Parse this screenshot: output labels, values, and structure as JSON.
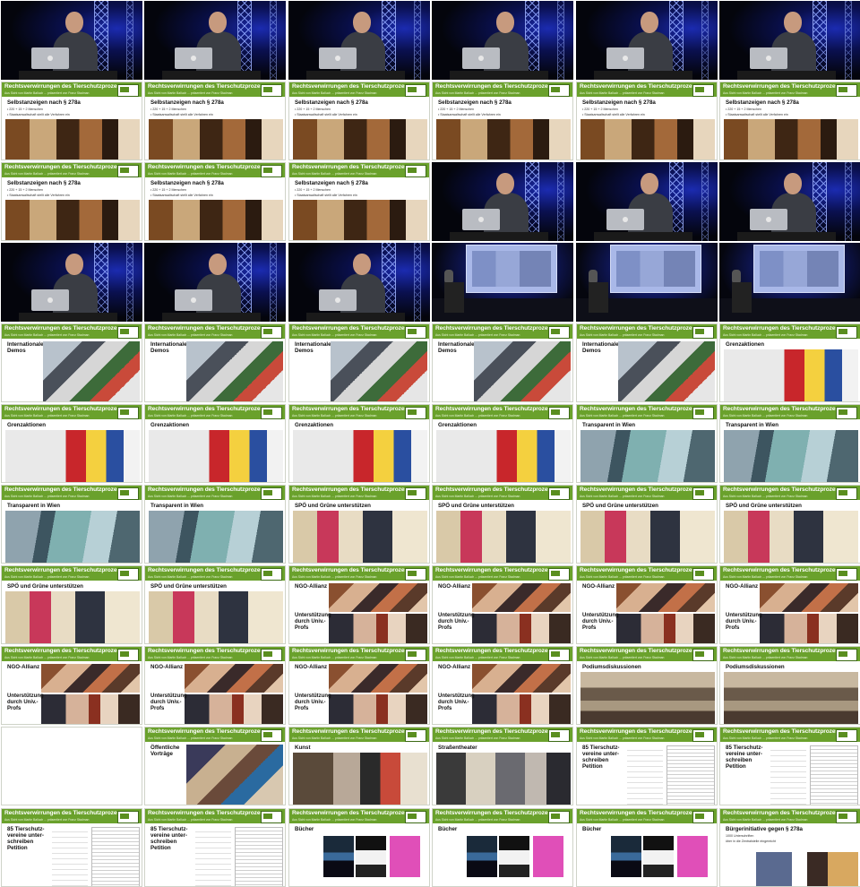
{
  "header": {
    "title": "Rechtsverwirrungen des Tierschutzprozesses",
    "subtitle": "Aus Sicht von Martin Balluch ... präsentiert von Franz Stadman"
  },
  "frames": [
    {
      "kind": "stage"
    },
    {
      "kind": "stage"
    },
    {
      "kind": "stage"
    },
    {
      "kind": "stage"
    },
    {
      "kind": "stage"
    },
    {
      "kind": "stage"
    },
    {
      "kind": "slide",
      "texture": "selbst",
      "title": "Selbstanzeigen nach § 278a",
      "bullets": [
        "• 220 + 15 + 2 Menschen",
        "• Staatsanwaltschaft stellt alle Verfahren ein"
      ]
    },
    {
      "kind": "slide",
      "texture": "selbst",
      "title": "Selbstanzeigen nach § 278a",
      "bullets": [
        "• 220 + 15 + 2 Menschen",
        "• Staatsanwaltschaft stellt alle Verfahren ein"
      ]
    },
    {
      "kind": "slide",
      "texture": "selbst",
      "title": "Selbstanzeigen nach § 278a",
      "bullets": [
        "• 220 + 15 + 2 Menschen",
        "• Staatsanwaltschaft stellt alle Verfahren ein"
      ]
    },
    {
      "kind": "slide",
      "texture": "selbst",
      "title": "Selbstanzeigen nach § 278a",
      "bullets": [
        "• 220 + 15 + 2 Menschen",
        "• Staatsanwaltschaft stellt alle Verfahren ein"
      ]
    },
    {
      "kind": "slide",
      "texture": "selbst",
      "title": "Selbstanzeigen nach § 278a",
      "bullets": [
        "• 220 + 15 + 2 Menschen",
        "• Staatsanwaltschaft stellt alle Verfahren ein"
      ]
    },
    {
      "kind": "slide",
      "texture": "selbst",
      "title": "Selbstanzeigen nach § 278a",
      "bullets": [
        "• 220 + 15 + 2 Menschen",
        "• Staatsanwaltschaft stellt alle Verfahren ein"
      ]
    },
    {
      "kind": "slide",
      "texture": "selbst",
      "title": "Selbstanzeigen nach § 278a",
      "bullets": [
        "• 220 + 15 + 2 Menschen",
        "• Staatsanwaltschaft stellt alle Verfahren ein"
      ]
    },
    {
      "kind": "slide",
      "texture": "selbst",
      "title": "Selbstanzeigen nach § 278a",
      "bullets": [
        "• 220 + 15 + 2 Menschen",
        "• Staatsanwaltschaft stellt alle Verfahren ein"
      ]
    },
    {
      "kind": "slide",
      "texture": "selbst",
      "title": "Selbstanzeigen nach § 278a",
      "bullets": [
        "• 220 + 15 + 2 Menschen",
        "• Staatsanwaltschaft stellt alle Verfahren ein"
      ]
    },
    {
      "kind": "stage"
    },
    {
      "kind": "stage"
    },
    {
      "kind": "stage"
    },
    {
      "kind": "stage"
    },
    {
      "kind": "stage"
    },
    {
      "kind": "stage"
    },
    {
      "kind": "hall"
    },
    {
      "kind": "hall"
    },
    {
      "kind": "hall"
    },
    {
      "kind": "slide",
      "texture": "demo",
      "title": "Internationale\nDemos",
      "layout": "titleonly"
    },
    {
      "kind": "slide",
      "texture": "demo",
      "title": "Internationale\nDemos",
      "layout": "titleonly"
    },
    {
      "kind": "slide",
      "texture": "demo",
      "title": "Internationale\nDemos",
      "layout": "titleonly"
    },
    {
      "kind": "slide",
      "texture": "demo",
      "title": "Internationale\nDemos",
      "layout": "titleonly"
    },
    {
      "kind": "slide",
      "texture": "demo",
      "title": "Internationale\nDemos",
      "layout": "titleonly"
    },
    {
      "kind": "slide",
      "texture": "grenz",
      "title": "Grenzaktionen",
      "layout": "titleonly"
    },
    {
      "kind": "slide",
      "texture": "grenz",
      "title": "Grenzaktionen",
      "layout": "titleonly"
    },
    {
      "kind": "slide",
      "texture": "grenz",
      "title": "Grenzaktionen",
      "layout": "titleonly"
    },
    {
      "kind": "slide",
      "texture": "grenz",
      "title": "Grenzaktionen",
      "layout": "titleonly"
    },
    {
      "kind": "slide",
      "texture": "grenz",
      "title": "Grenzaktionen",
      "layout": "titleonly"
    },
    {
      "kind": "slide",
      "texture": "wien",
      "title": "Transparent in Wien",
      "layout": "titleonly"
    },
    {
      "kind": "slide",
      "texture": "wien",
      "title": "Transparent in Wien",
      "layout": "titleonly"
    },
    {
      "kind": "slide",
      "texture": "wien",
      "title": "Transparent in Wien",
      "layout": "titleonly"
    },
    {
      "kind": "slide",
      "texture": "wien",
      "title": "Transparent in Wien",
      "layout": "titleonly"
    },
    {
      "kind": "slide",
      "texture": "spoe",
      "title": "SPÖ und Grüne unterstützen",
      "layout": "titleonly"
    },
    {
      "kind": "slide",
      "texture": "spoe",
      "title": "SPÖ und Grüne unterstützen",
      "layout": "titleonly"
    },
    {
      "kind": "slide",
      "texture": "spoe",
      "title": "SPÖ und Grüne unterstützen",
      "layout": "titleonly"
    },
    {
      "kind": "slide",
      "texture": "spoe",
      "title": "SPÖ und Grüne unterstützen",
      "layout": "titleonly"
    },
    {
      "kind": "slide",
      "texture": "spoe",
      "title": "SPÖ und Grüne unterstützen",
      "layout": "titleonly"
    },
    {
      "kind": "slide",
      "texture": "spoe",
      "title": "SPÖ und Grüne unterstützen",
      "layout": "titleonly"
    },
    {
      "kind": "slide",
      "texture": "ngo",
      "title": "NGO-Allianz",
      "side": "Unterstützung\ndurch Univ.-\nProfs",
      "layout": "ngo"
    },
    {
      "kind": "slide",
      "texture": "ngo",
      "title": "NGO-Allianz",
      "side": "Unterstützung\ndurch Univ.-\nProfs",
      "layout": "ngo"
    },
    {
      "kind": "slide",
      "texture": "ngo",
      "title": "NGO-Allianz",
      "side": "Unterstützung\ndurch Univ.-\nProfs",
      "layout": "ngo"
    },
    {
      "kind": "slide",
      "texture": "ngo",
      "title": "NGO-Allianz",
      "side": "Unterstützung\ndurch Univ.-\nProfs",
      "layout": "ngo"
    },
    {
      "kind": "slide",
      "texture": "ngo",
      "title": "NGO-Allianz",
      "side": "Unterstützung\ndurch Univ.-\nProfs",
      "layout": "ngo"
    },
    {
      "kind": "slide",
      "texture": "ngo",
      "title": "NGO-Allianz",
      "side": "Unterstützung\ndurch Univ.-\nProfs",
      "layout": "ngo"
    },
    {
      "kind": "slide",
      "texture": "ngo",
      "title": "NGO-Allianz",
      "side": "Unterstützung\ndurch Univ.-\nProfs",
      "layout": "ngo"
    },
    {
      "kind": "slide",
      "texture": "ngo",
      "title": "NGO-Allianz",
      "side": "Unterstützung\ndurch Univ.-\nProfs",
      "layout": "ngo"
    },
    {
      "kind": "slide",
      "texture": "podium",
      "title": "Podiumsdiskussionen",
      "layout": "titleonly"
    },
    {
      "kind": "slide",
      "texture": "podium",
      "title": "Podiumsdiskussionen",
      "layout": "titleonly"
    },
    {
      "kind": "blank"
    },
    {
      "kind": "slide",
      "texture": "vortr",
      "title": "Öffentliche\nVorträge",
      "layout": "titleonly"
    },
    {
      "kind": "slide",
      "texture": "kunst",
      "title": "Kunst",
      "layout": "titleonly"
    },
    {
      "kind": "slide",
      "texture": "strass",
      "title": "Straßentheater",
      "layout": "titleonly"
    },
    {
      "kind": "slide",
      "texture": "petit",
      "title": "85 Tierschutz-\nvereine unter-\nschreiben\nPetition",
      "layout": "petition"
    },
    {
      "kind": "slide",
      "texture": "petit",
      "title": "85 Tierschutz-\nvereine unter-\nschreiben\nPetition",
      "layout": "petition"
    },
    {
      "kind": "slide",
      "texture": "petit",
      "title": "85 Tierschutz-\nvereine unter-\nschreiben\nPetition",
      "layout": "petition"
    },
    {
      "kind": "slide",
      "texture": "petit",
      "title": "85 Tierschutz-\nvereine unter-\nschreiben\nPetition",
      "layout": "petition"
    },
    {
      "kind": "slide",
      "texture": "books",
      "title": "Bücher",
      "layout": "books"
    },
    {
      "kind": "slide",
      "texture": "books",
      "title": "Bücher",
      "layout": "books"
    },
    {
      "kind": "slide",
      "texture": "books",
      "title": "Bücher",
      "layout": "books"
    },
    {
      "kind": "slide",
      "texture": "bueger",
      "title": "Bürgerinitiative gegen § 278a",
      "bullets": [
        "1000 Unterschriften",
        "über in die Zentralstelle eingereicht"
      ],
      "layout": "bueger"
    }
  ]
}
